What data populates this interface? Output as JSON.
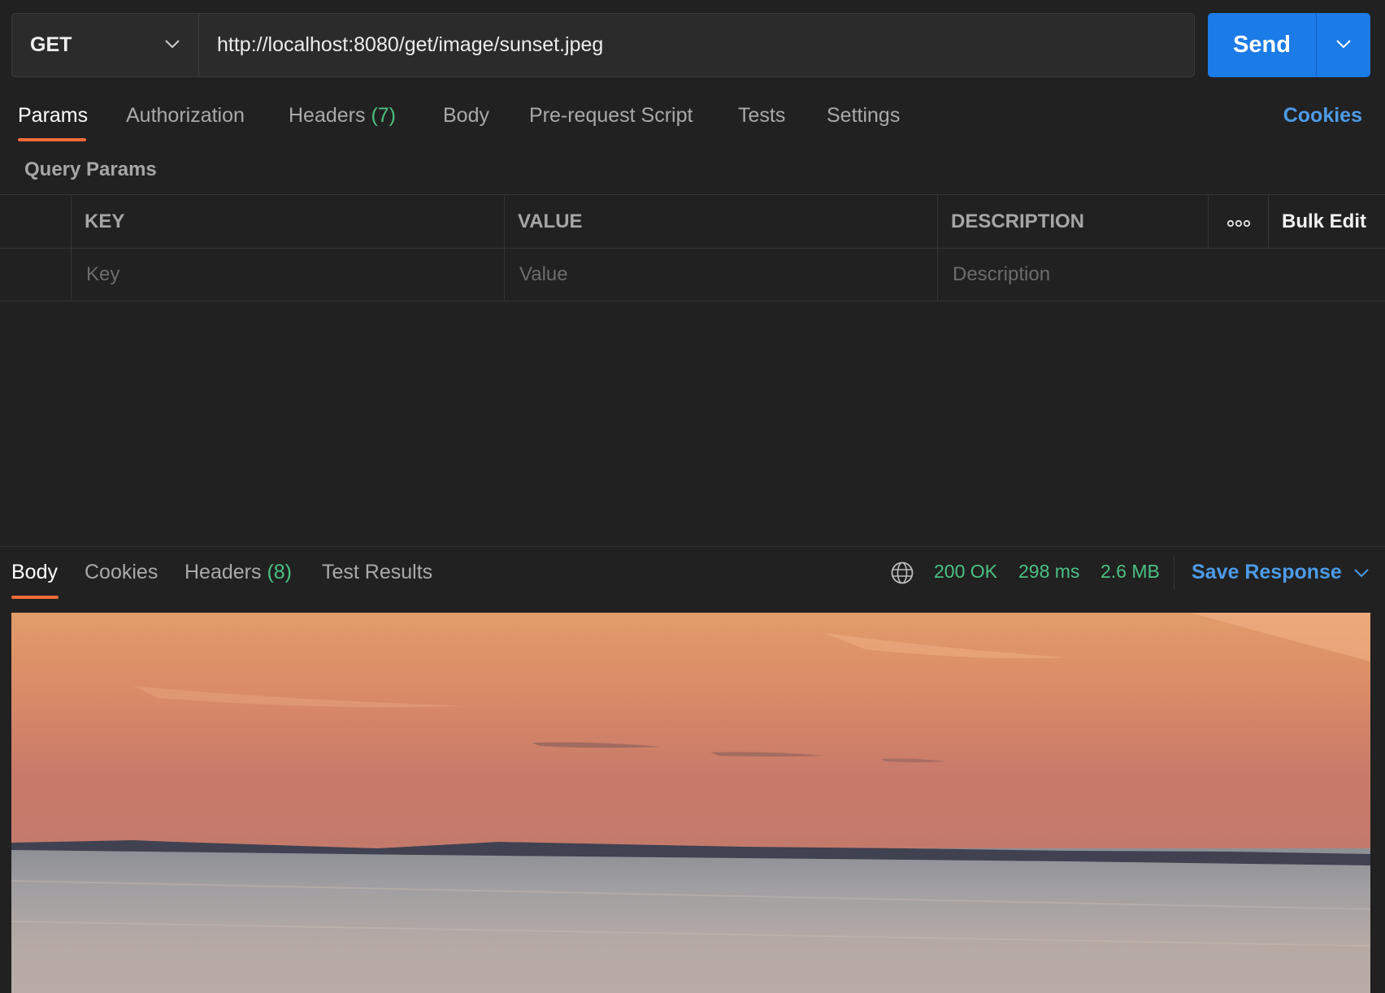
{
  "request": {
    "method": "GET",
    "url": "http://localhost:8080/get/image/sunset.jpeg",
    "send_label": "Send"
  },
  "request_tabs": {
    "params": "Params",
    "authorization": "Authorization",
    "headers": "Headers",
    "headers_count": "(7)",
    "body": "Body",
    "pre_request": "Pre-request Script",
    "tests": "Tests",
    "settings": "Settings",
    "cookies": "Cookies"
  },
  "query_params": {
    "title": "Query Params",
    "columns": {
      "key": "KEY",
      "value": "VALUE",
      "description": "DESCRIPTION",
      "bulk_edit": "Bulk Edit"
    },
    "placeholders": {
      "key": "Key",
      "value": "Value",
      "description": "Description"
    }
  },
  "response": {
    "tabs": {
      "body": "Body",
      "cookies": "Cookies",
      "headers": "Headers",
      "headers_count": "(8)",
      "test_results": "Test Results"
    },
    "status": "200 OK",
    "time": "298 ms",
    "size": "2.6 MB",
    "save_label": "Save Response"
  },
  "icons": {
    "method_dropdown": "chevron-down-icon",
    "send_dropdown": "chevron-down-icon",
    "more": "more-options-icon",
    "network": "globe-icon",
    "save_dropdown": "chevron-down-icon"
  },
  "colors": {
    "background": "#212121",
    "accent_blue": "#1b7be7",
    "link_blue": "#4c9be8",
    "active_tab_underline": "#f26b3a",
    "success_green": "#4bc184"
  }
}
